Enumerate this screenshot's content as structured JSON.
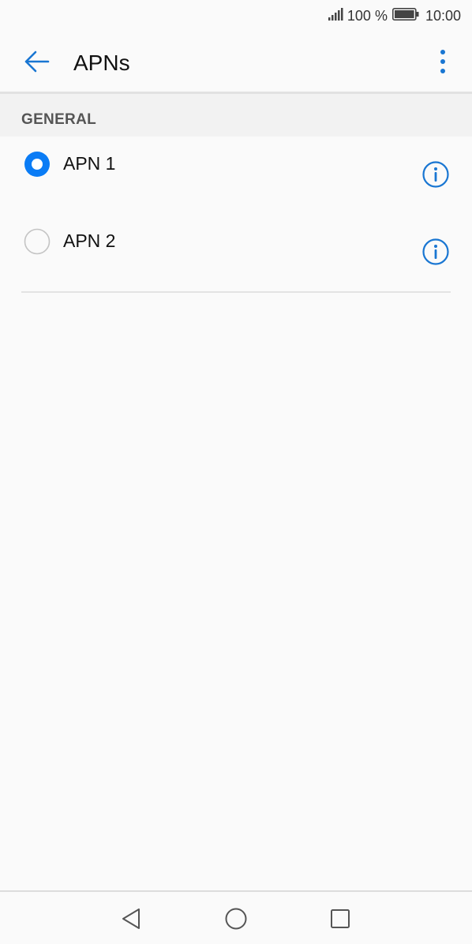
{
  "status_bar": {
    "battery_percent": "100 %",
    "time": "10:00",
    "icons": [
      "signal-icon",
      "battery-icon"
    ]
  },
  "app_bar": {
    "title": "APNs",
    "back_icon": "arrow-left-icon",
    "menu_icon": "more-vert-icon"
  },
  "section": {
    "title": "GENERAL"
  },
  "apns": [
    {
      "label": "APN 1",
      "selected": true
    },
    {
      "label": "APN 2",
      "selected": false
    }
  ],
  "nav_bar": {
    "icons": [
      "nav-back-icon",
      "nav-home-icon",
      "nav-recent-icon"
    ]
  },
  "colors": {
    "accent": "#1976d2",
    "radio_selected": "#0a7cf5",
    "radio_unselected": "#c4c4c4"
  }
}
